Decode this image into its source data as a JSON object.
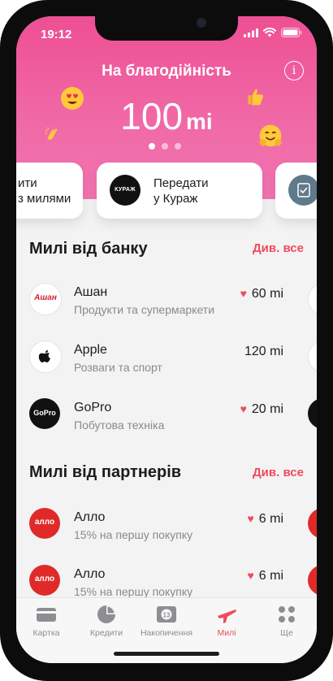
{
  "status": {
    "time": "19:12"
  },
  "hero": {
    "title": "На благодійність",
    "amount": "100",
    "unit": "mi",
    "page_indicator": {
      "total": 3,
      "active": 1
    }
  },
  "action_cards": [
    {
      "line1": "ити",
      "line2": "з милями"
    },
    {
      "line1": "Передати",
      "line2": "у Кураж",
      "logo_text": "КУРАЖ"
    },
    {
      "line1": "",
      "line2": ""
    }
  ],
  "bank_section": {
    "title": "Милі від банку",
    "see_all": "Див. все",
    "items": [
      {
        "name": "Ашан",
        "category": "Продукти та супермаркети",
        "miles": "60 mi",
        "favorite": true,
        "logo": "Ашан"
      },
      {
        "name": "Apple",
        "category": "Розваги та спорт",
        "miles": "120 mi",
        "favorite": false,
        "logo": "apple-icon"
      },
      {
        "name": "GoPro",
        "category": "Побутова техніка",
        "miles": "20 mi",
        "favorite": true,
        "logo": "GoPro"
      }
    ]
  },
  "partner_section": {
    "title": "Милі від партнерів",
    "see_all": "Див. все",
    "items": [
      {
        "name": "Алло",
        "category": "15% на першу покупку",
        "miles": "6 mi",
        "favorite": true,
        "logo": "алло"
      },
      {
        "name": "Алло",
        "category": "15% на першу покупку",
        "miles": "6 mi",
        "favorite": true,
        "logo": "алло"
      }
    ]
  },
  "tabbar": {
    "tabs": [
      {
        "label": "Картка",
        "icon": "card-icon",
        "active": false
      },
      {
        "label": "Кредити",
        "icon": "pie-chart-icon",
        "active": false
      },
      {
        "label": "Накопичення",
        "icon": "savings-icon",
        "active": false
      },
      {
        "label": "Милі",
        "icon": "airplane-icon",
        "active": true
      },
      {
        "label": "Ще",
        "icon": "grid-icon",
        "active": false
      }
    ]
  },
  "colors": {
    "accent": "#f04b5d",
    "hero_gradient_top": "#ee4f93",
    "hero_gradient_bottom": "#f374b2",
    "tab_inactive": "#8e8e92"
  }
}
